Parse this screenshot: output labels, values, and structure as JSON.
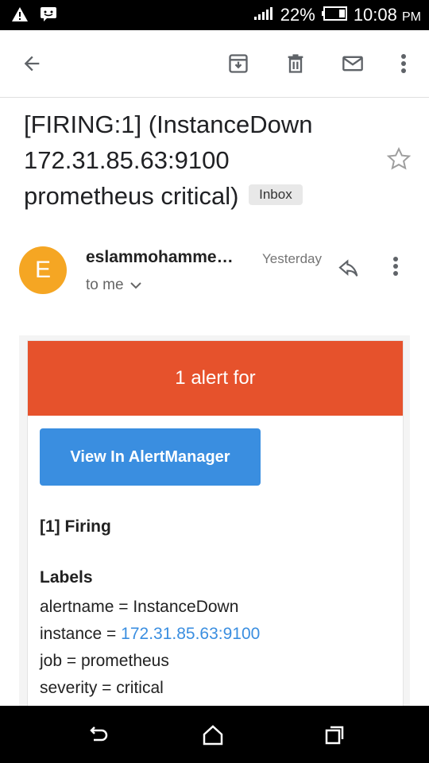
{
  "status_bar": {
    "battery": "22%",
    "time": "10:08",
    "ampm": "PM"
  },
  "toolbar": {
    "icons": [
      "back-arrow-icon",
      "archive-icon",
      "delete-icon",
      "mark-unread-icon",
      "more-vert-icon"
    ]
  },
  "email": {
    "subject_line1": "[FIRING:1]  (InstanceDown",
    "subject_line2": "172.31.85.63:9100",
    "subject_line3": "prometheus critical)",
    "label_chip": "Inbox",
    "sender_initial": "E",
    "sender_name": "eslammohamme…",
    "date": "Yesterday",
    "recipient": "to me"
  },
  "body": {
    "header": "1 alert for",
    "button_label": "View In AlertManager",
    "firing_title": "[1] Firing",
    "labels_title": "Labels",
    "labels": {
      "alertname": "alertname = InstanceDown",
      "instance_prefix": "instance = ",
      "instance_link": "172.31.85.63:9100",
      "job": "job = prometheus",
      "severity": "severity = critical"
    }
  },
  "colors": {
    "alert_header": "#e6522c",
    "button": "#3a8ee0",
    "avatar": "#f5a623"
  }
}
